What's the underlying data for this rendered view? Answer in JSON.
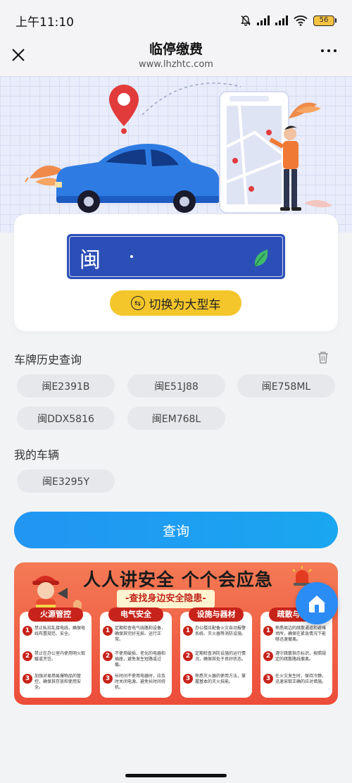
{
  "status_bar": {
    "time": "上午11:10",
    "battery": "56"
  },
  "nav": {
    "title": "临停缴费",
    "subtitle": "www.lhzhtc.com"
  },
  "plate": {
    "province": "闽"
  },
  "switch_button": {
    "label": "切换为大型车"
  },
  "history": {
    "title": "车牌历史查询",
    "items": [
      "闽E2391B",
      "闽E51J88",
      "闽E758ML",
      "闽DDX5816",
      "闽EM768L"
    ]
  },
  "my_vehicles": {
    "title": "我的车辆",
    "items": [
      "闽E3295Y"
    ]
  },
  "query_button": {
    "label": "查询"
  },
  "banner": {
    "title": "人人讲安全 个个会应急",
    "subtitle": "-查找身边安全隐患-",
    "columns": [
      {
        "head": "火源管控",
        "items": [
          "禁止私拉乱接电线，确保电线布置规范、安全。",
          "禁止在办公室内使用明火取暖或烹饪。",
          "加强对易燃易爆物品的管控，确保其存放和使用安全。"
        ]
      },
      {
        "head": "电气安全",
        "items": [
          "定期检查电气线路和设备，确保其完好无损、运行正常。",
          "不使用破损、老化的电器和插座，避免发生短路或过载。",
          "长时间不使用电器时，应及时关闭电源，避免长时间待机。"
        ]
      },
      {
        "head": "设施与器材",
        "items": [
          "办公楼应配备火灾自动报警系统、灭火器等消防设施。",
          "定期检查消防设施的运行情况，确保其处于良好状态。",
          "熟悉灭火器的使用方法，掌握基本的灭火技能。"
        ]
      },
      {
        "head": "疏散与逃生",
        "items": [
          "熟悉周边的疏散通道和避难场所，确保在紧急情况下能够迅速撤离。",
          "遵守疏散指示标识，按照规定的疏散路线撤离。",
          "在火灾发生时，保持冷静，迅速采取正确的应对措施。"
        ]
      }
    ]
  },
  "colors": {
    "primary": "#1e9bf3",
    "plate_blue": "#2c4fb7",
    "switch_yellow": "#f4c62b",
    "chip_bg": "#e7e8eb"
  }
}
